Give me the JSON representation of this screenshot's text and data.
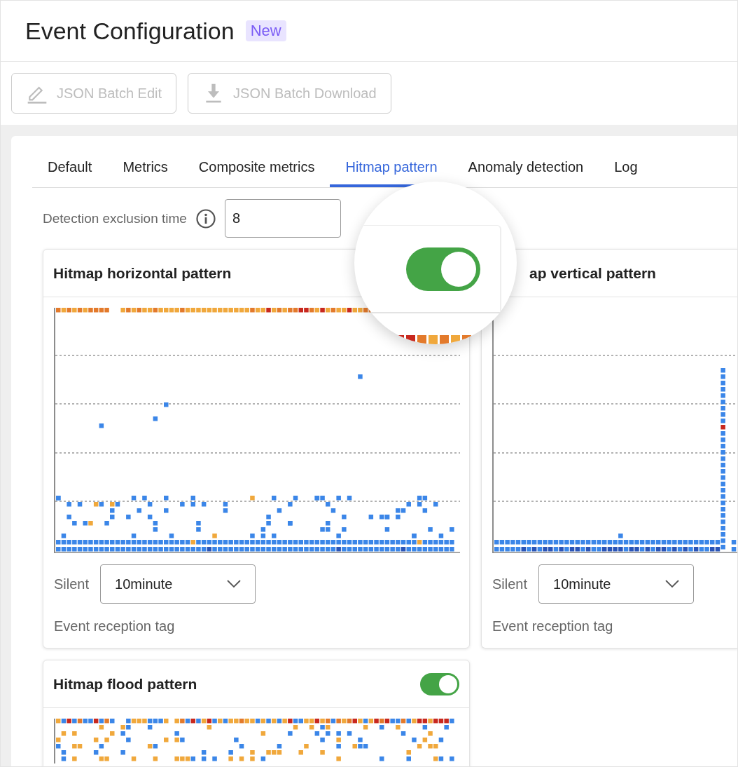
{
  "header": {
    "title": "Event Configuration",
    "badge": "New"
  },
  "toolbar": [
    {
      "label": "JSON Batch Edit",
      "kind": "edit",
      "disabled": true
    },
    {
      "label": "JSON Batch Download",
      "kind": "download",
      "disabled": true
    }
  ],
  "tabs": [
    {
      "label": "Default",
      "selected": false
    },
    {
      "label": "Metrics",
      "selected": false
    },
    {
      "label": "Composite metrics",
      "selected": false
    },
    {
      "label": "Hitmap pattern",
      "selected": true
    },
    {
      "label": "Anomaly detection",
      "selected": false
    },
    {
      "label": "Log",
      "selected": false
    }
  ],
  "exclusion": {
    "label": "Detection exclusion time",
    "value": "8"
  },
  "cards": [
    {
      "title": "Hitmap horizontal pattern",
      "kind": "horizontal",
      "silent_label": "Silent",
      "silent_value": "10minute",
      "tag_label": "Event reception tag"
    },
    {
      "title": "ap vertical pattern",
      "kind": "vertical",
      "silent_label": "Silent",
      "silent_value": "10minute",
      "tag_label": "Event reception tag"
    },
    {
      "title": "Hitmap flood pattern",
      "kind": "flood",
      "toggle_on": true
    }
  ],
  "magnifier": {
    "toggle_on": true
  }
}
